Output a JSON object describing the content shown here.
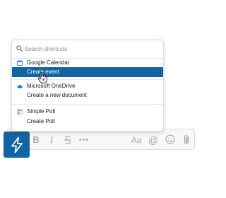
{
  "search": {
    "placeholder": "Search shortcuts",
    "value": ""
  },
  "groups": [
    {
      "name": "Google Calendar",
      "icon": "calendar-icon",
      "items": [
        {
          "label": "Create event",
          "selected": true
        }
      ]
    },
    {
      "name": "Microsoft OneDrive",
      "icon": "cloud-icon",
      "items": [
        {
          "label": "Create a new document",
          "selected": false
        }
      ]
    },
    {
      "name": "Simple Poll",
      "icon": "poll-icon",
      "items": [
        {
          "label": "Create Poll",
          "selected": false
        }
      ]
    }
  ],
  "toolbar": {
    "bold_label": "B",
    "italic_label": "I",
    "more_label": "•••",
    "text_format_label": "Aa",
    "mention_label": "@"
  },
  "colors": {
    "accent": "#1264a3",
    "google_calendar": "#4285f4",
    "onedrive": "#0f78d4",
    "simple_poll": "#9b59b6"
  }
}
